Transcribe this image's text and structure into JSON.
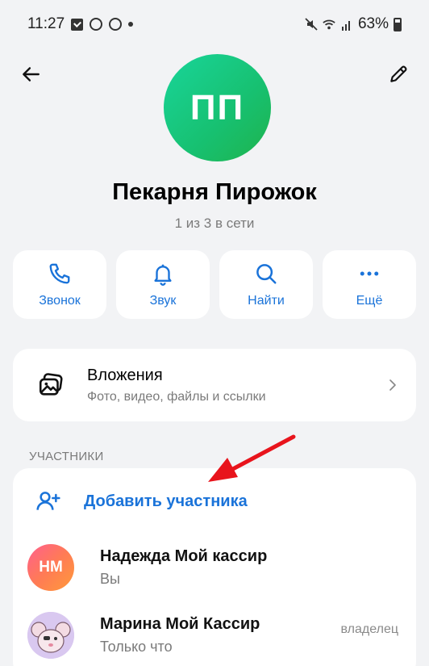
{
  "status_bar": {
    "time": "11:27",
    "battery": "63%",
    "icons": [
      "checkbox-icon",
      "chat-icon",
      "sync-icon",
      "dot-icon",
      "mute-icon",
      "wifi-icon",
      "signal-icon",
      "battery-icon"
    ]
  },
  "header": {
    "avatar_initials": "ПП",
    "title": "Пекарня Пирожок",
    "subtitle": "1 из 3 в сети"
  },
  "actions": [
    {
      "label": "Звонок",
      "icon": "phone-icon"
    },
    {
      "label": "Звук",
      "icon": "bell-icon"
    },
    {
      "label": "Найти",
      "icon": "search-icon"
    },
    {
      "label": "Ещё",
      "icon": "more-icon"
    }
  ],
  "attachments": {
    "title": "Вложения",
    "subtitle": "Фото, видео, файлы и ссылки"
  },
  "members_section": {
    "label": "УЧАСТНИКИ",
    "add_label": "Добавить участника",
    "members": [
      {
        "initials": "НМ",
        "name": "Надежда Мой кассир",
        "status": "Вы",
        "role": ""
      },
      {
        "initials": "",
        "name": "Марина Мой Кассир",
        "status": "Только что",
        "role": "владелец"
      }
    ]
  },
  "colors": {
    "accent": "#1a73d9",
    "background": "#f2f3f5",
    "annotation_arrow": "#e8141c"
  }
}
